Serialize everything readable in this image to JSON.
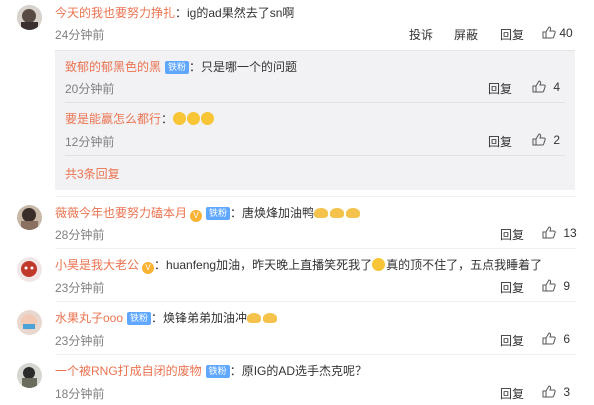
{
  "comments": [
    {
      "user": "今天的我也要努力挣扎",
      "text": "：ig的ad果然去了sn啊",
      "time": "24分钟前",
      "report": "投诉",
      "block": "屏蔽",
      "reply": "回复",
      "likes": "40"
    },
    {
      "user": "薇薇今年也要努力磕本月",
      "badge": "铁粉",
      "text": "：唐焕烽加油鸭",
      "time": "28分钟前",
      "reply": "回复",
      "likes": "13"
    },
    {
      "user": "小昊是我大老公",
      "text": "：huanfeng加油，昨天晚上直播笑死我了",
      "text2": "真的顶不住了，五点我睡着了",
      "time": "23分钟前",
      "reply": "回复",
      "likes": "9"
    },
    {
      "user": "水果丸子ooo",
      "badge": "铁粉",
      "text": "：焕锋弟弟加油冲",
      "time": "23分钟前",
      "reply": "回复",
      "likes": "6"
    },
    {
      "user": "一个被RNG打成自闭的废物",
      "badge": "铁粉",
      "text": "：原IG的AD选手杰克呢？",
      "time": "18分钟前",
      "reply": "回复",
      "likes": "3"
    }
  ],
  "replies": [
    {
      "user": "致郁的郁黑色的黑",
      "badge": "铁粉",
      "text": "：只是哪一个的问题",
      "time": "20分钟前",
      "reply": "回复",
      "likes": "4"
    },
    {
      "user": "要是能赢怎么都行",
      "text": "：",
      "time": "12分钟前",
      "reply": "回复",
      "likes": "2"
    }
  ],
  "more_replies": "共3条回复",
  "colors": {
    "username": "#eb7350",
    "badge": "#5fa7ff",
    "reply_bg": "#f2f2f5"
  }
}
